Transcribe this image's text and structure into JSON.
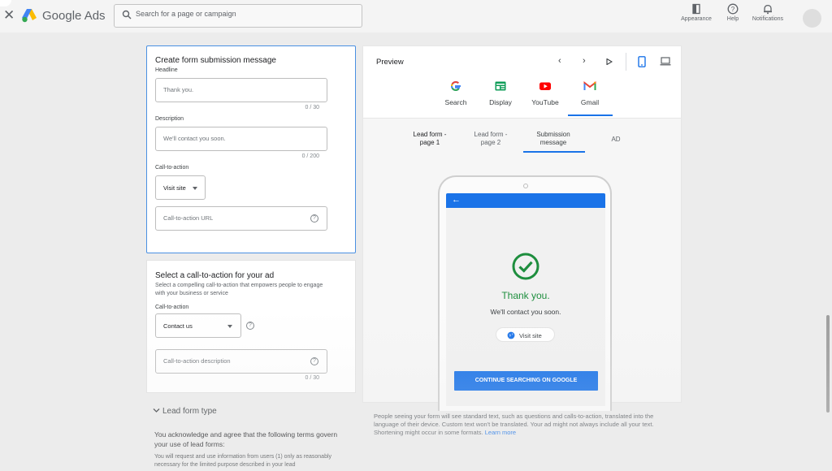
{
  "header": {
    "brand": "Google Ads",
    "search": {
      "placeholder": "Search for a page or campaign"
    },
    "actions": [
      {
        "label": "Appearance",
        "icon": "appearance-icon"
      },
      {
        "label": "Help",
        "icon": "help-icon"
      },
      {
        "label": "Notifications",
        "icon": "bell-icon"
      }
    ]
  },
  "form_message": {
    "title": "Create form submission message",
    "headline": {
      "label": "Headline",
      "placeholder": "Thank you.",
      "counter": "0 / 30"
    },
    "description": {
      "label": "Description",
      "placeholder": "We'll contact you soon.",
      "counter": "0 / 200"
    },
    "cta": {
      "label": "Call-to-action",
      "selected": "Visit site",
      "url_placeholder": "Call-to-action URL"
    }
  },
  "ad_cta": {
    "title": "Select a call-to-action for your ad",
    "description": "Select a compelling call-to-action that empowers people to engage with your business or service",
    "label": "Call-to-action",
    "selected": "Contact us",
    "desc_placeholder": "Call-to-action description",
    "counter": "0 / 30"
  },
  "lead_form_type": {
    "title": "Lead form type",
    "body": "You acknowledge and agree that the following terms govern your use of lead forms:",
    "small": "You will request and use information from users (1) only as reasonably necessary for the limited purpose described in your lead"
  },
  "preview": {
    "title": "Preview",
    "networks": [
      {
        "label": "Search",
        "icon": "google-g-icon"
      },
      {
        "label": "Display",
        "icon": "display-icon"
      },
      {
        "label": "YouTube",
        "icon": "youtube-icon"
      },
      {
        "label": "Gmail",
        "icon": "gmail-icon"
      }
    ],
    "selected_network": "Gmail",
    "subtabs": [
      {
        "line1": "Lead form -",
        "line2": "page 1"
      },
      {
        "line1": "Lead form -",
        "line2": "page 2"
      },
      {
        "line1": "Submission",
        "line2": "message"
      },
      {
        "line1": "AD",
        "line2": ""
      }
    ],
    "selected_subtab": "Submission message",
    "phone": {
      "thank_you": "Thank you.",
      "contact": "We'll contact you soon.",
      "visit_chip": "Visit site",
      "continue_button": "CONTINUE SEARCHING ON GOOGLE"
    },
    "disclaimer": "People seeing your form will see standard text, such as questions and calls-to-action, translated into the language of their device. Custom text won't be translated. Your ad might not always include all your text. Shortening might occur in some formats.",
    "learn_more": "Learn more"
  },
  "colors": {
    "accent": "#1a73e8",
    "success": "#1e8e3e",
    "focus_border": "#4a90e2"
  }
}
